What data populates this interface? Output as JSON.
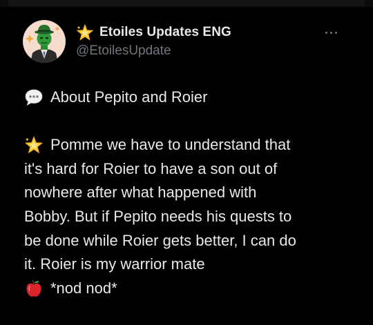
{
  "author": {
    "display_name": "Etoiles Updates ENG",
    "handle": "@EtoilesUpdate",
    "name_badge_icon": "glowing-star-icon"
  },
  "tweet": {
    "heading": "About Pepito and Roier",
    "heading_icon": "speech-bubble-icon",
    "paragraph_icon": "glowing-star-icon",
    "lines": [
      "Pomme we have to understand that",
      "it's hard for Roier to have a son out of",
      "nowhere after what happened with",
      "Bobby. But if Pepito needs his quests to",
      "be done while Roier gets better, I can do",
      "it. Roier is my warrior mate"
    ],
    "signoff_icon": "red-apple-icon",
    "signoff": "*nod nod*"
  },
  "colors": {
    "background": "#000000",
    "primary_text": "#e7e9ea",
    "secondary_text": "#71767b",
    "avatar_bg": "#f6dccd",
    "avatar_figure": "#2f9a3a",
    "star": "#f7c531",
    "apple": "#d9232d"
  }
}
